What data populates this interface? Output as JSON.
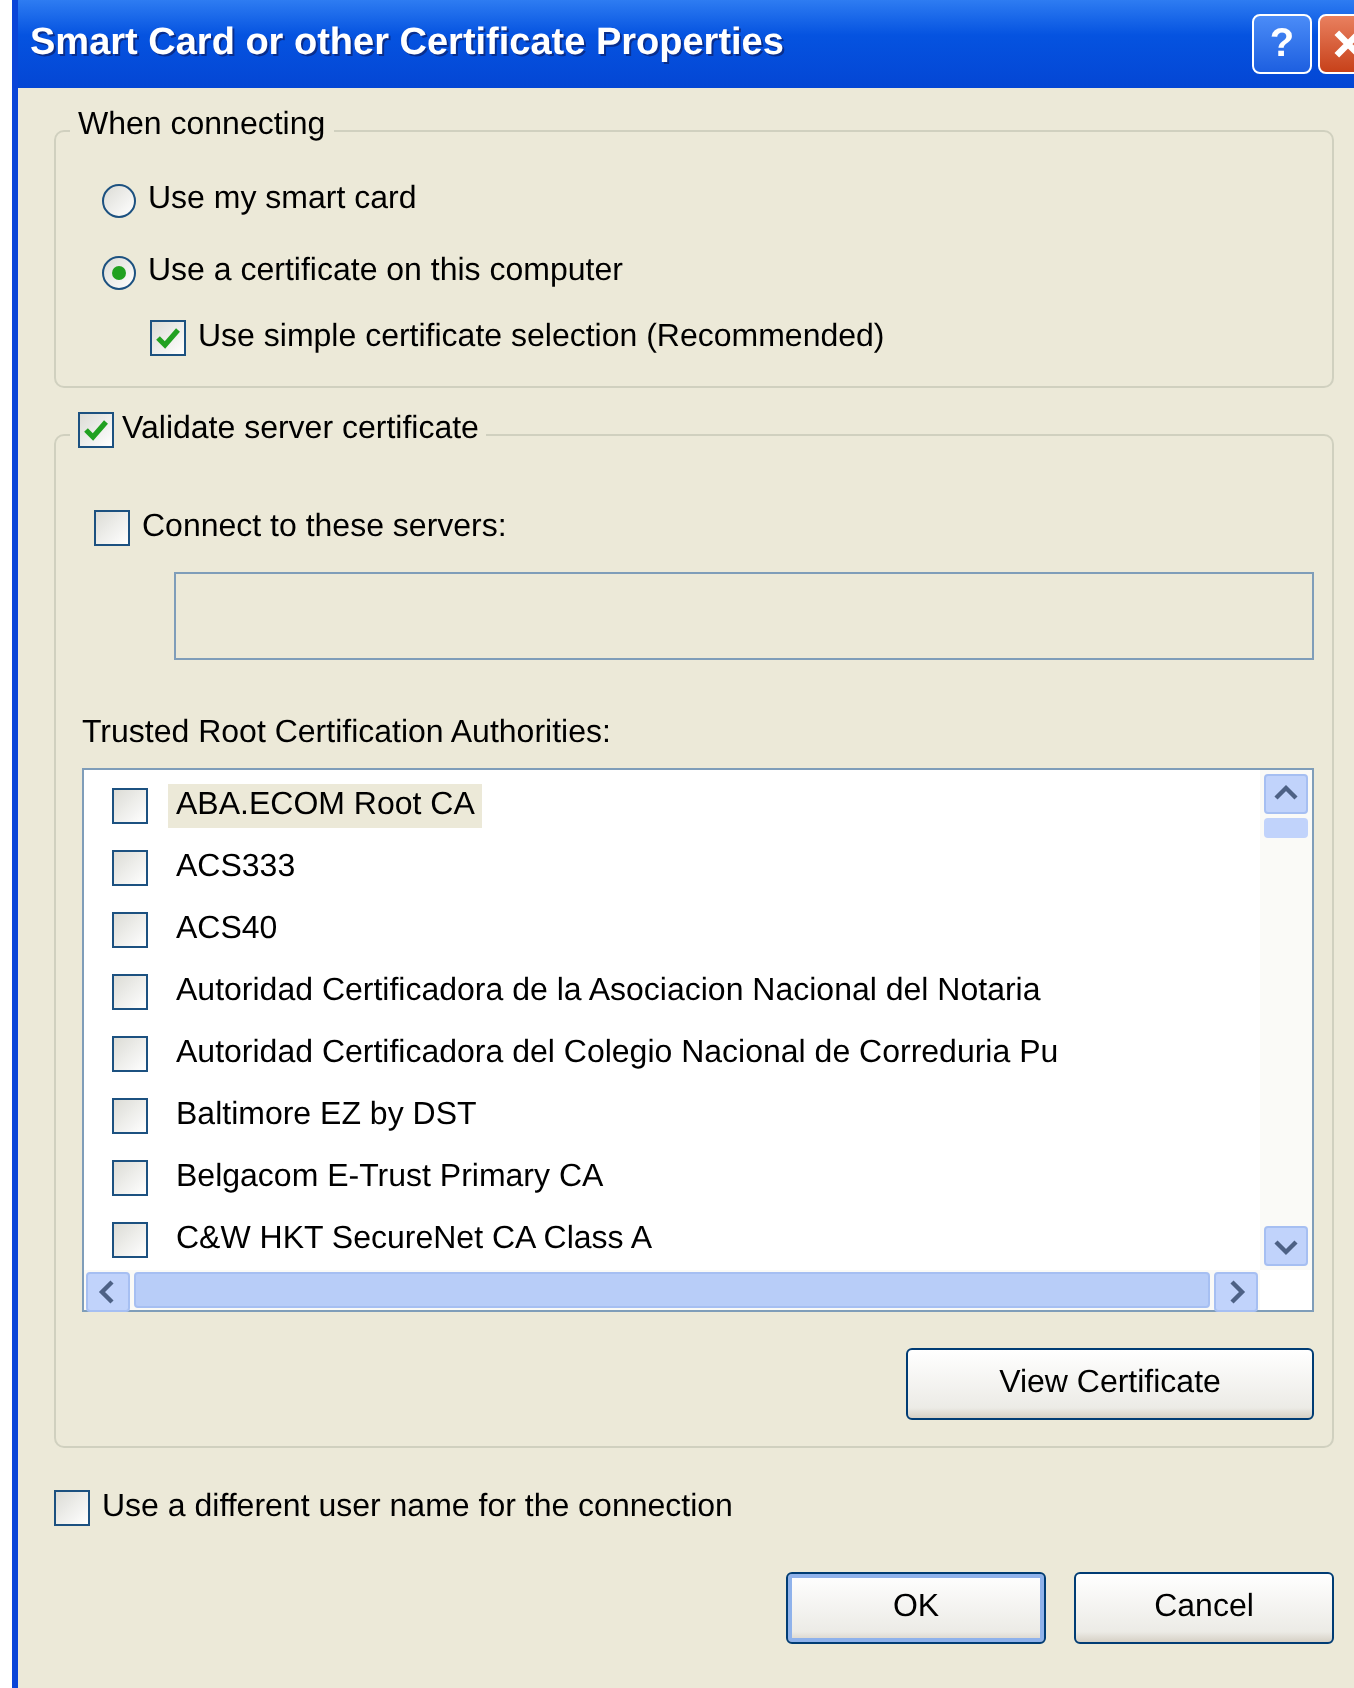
{
  "window": {
    "title": "Smart Card or other Certificate Properties",
    "help": "?"
  },
  "connecting": {
    "legend": "When connecting",
    "options": [
      {
        "label": "Use my smart card",
        "selected": false
      },
      {
        "label": "Use a certificate on this computer",
        "selected": true
      }
    ],
    "simple_selection": {
      "label": "Use simple certificate selection (Recommended)",
      "checked": true
    }
  },
  "validate": {
    "label": "Validate server certificate",
    "checked": true
  },
  "connect_servers": {
    "label": "Connect to these servers:",
    "checked": false
  },
  "trusted_roots": {
    "label": "Trusted Root Certification Authorities:",
    "items": [
      {
        "label": "ABA.ECOM Root CA",
        "checked": false,
        "selected": true
      },
      {
        "label": "ACS333",
        "checked": false,
        "selected": false
      },
      {
        "label": "ACS40",
        "checked": false,
        "selected": false
      },
      {
        "label": "Autoridad Certificadora de la Asociacion Nacional del Notaria",
        "checked": false,
        "selected": false
      },
      {
        "label": "Autoridad Certificadora del Colegio Nacional de Correduria Pu",
        "checked": false,
        "selected": false
      },
      {
        "label": "Baltimore EZ by DST",
        "checked": false,
        "selected": false
      },
      {
        "label": "Belgacom E-Trust Primary CA",
        "checked": false,
        "selected": false
      },
      {
        "label": "C&W HKT SecureNet CA Class A",
        "checked": false,
        "selected": false
      }
    ]
  },
  "view_certificate": "View Certificate",
  "different_user": {
    "label": "Use a different user name for the connection",
    "checked": false
  },
  "buttons": [
    {
      "label": "OK",
      "kind": "default"
    },
    {
      "label": "Cancel",
      "kind": "normal"
    }
  ]
}
